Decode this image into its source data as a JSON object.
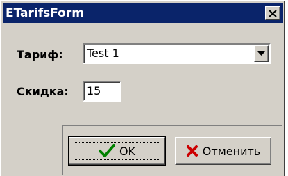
{
  "window": {
    "title": "ETarifsForm",
    "close_icon": "close-icon"
  },
  "form": {
    "tariff_label": "Тариф:",
    "tariff_value": "Test 1",
    "discount_label": "Скидка:",
    "discount_value": "15"
  },
  "buttons": {
    "ok_label": "OK",
    "ok_icon": "checkmark-icon",
    "cancel_label": "Отменить",
    "cancel_icon": "cross-icon"
  },
  "colors": {
    "titlebar": "#0a246a",
    "face": "#d4d0c8",
    "ok_icon": "#008000",
    "cancel_icon": "#cc0000"
  }
}
